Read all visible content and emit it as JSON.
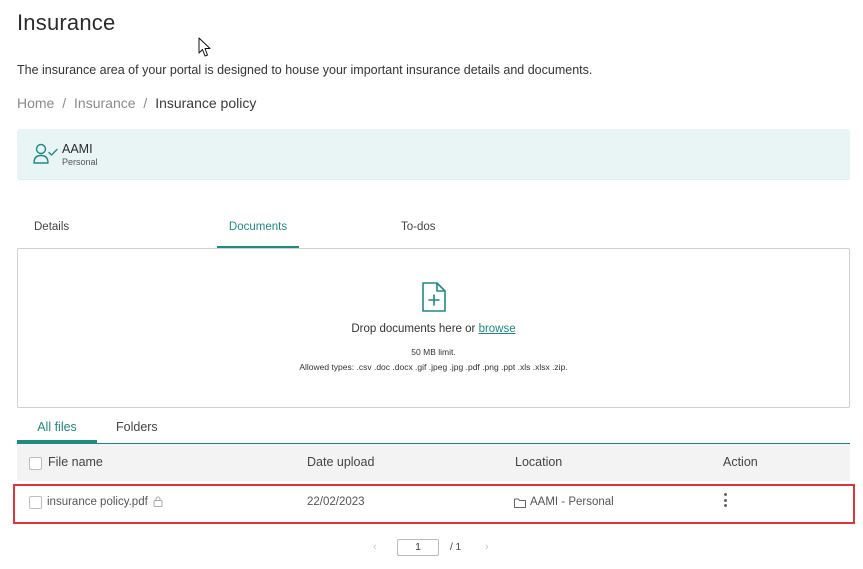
{
  "page": {
    "title": "Insurance",
    "description": "The insurance area of your portal is designed to house your important insurance details and documents."
  },
  "breadcrumb": {
    "items": [
      "Home",
      "Insurance",
      "Insurance policy"
    ],
    "separator": "/"
  },
  "policy_card": {
    "name": "AAMI",
    "type": "Personal",
    "icon": "user-check-icon"
  },
  "tabs": [
    {
      "label": "Details",
      "active": false
    },
    {
      "label": "Documents",
      "active": true
    },
    {
      "label": "To-dos",
      "active": false
    }
  ],
  "dropzone": {
    "icon": "file-add-icon",
    "text": "Drop documents here or",
    "browse_label": "browse",
    "limit": "50 MB limit.",
    "allowed_types": "Allowed types: .csv .doc .docx .gif .jpeg .jpg .pdf .png .ppt .xls .xlsx .zip."
  },
  "subtabs": [
    {
      "label": "All files",
      "active": true
    },
    {
      "label": "Folders",
      "active": false
    }
  ],
  "table": {
    "columns": [
      "File name",
      "Date upload",
      "Location",
      "Action"
    ],
    "rows": [
      {
        "file_name": "insurance policy.pdf",
        "locked": true,
        "date": "22/02/2023",
        "location": "AAMI - Personal",
        "action_icon": "kebab-menu-icon"
      }
    ]
  },
  "pagination": {
    "current_page": "1",
    "total": "/ 1",
    "prev_icon": "chevron-left-icon",
    "next_icon": "chevron-right-icon"
  },
  "colors": {
    "accent": "#1f8a82",
    "card_background": "#e9f5f4",
    "highlight_border": "#e0343c",
    "table_header_background": "#f3f3f3"
  }
}
